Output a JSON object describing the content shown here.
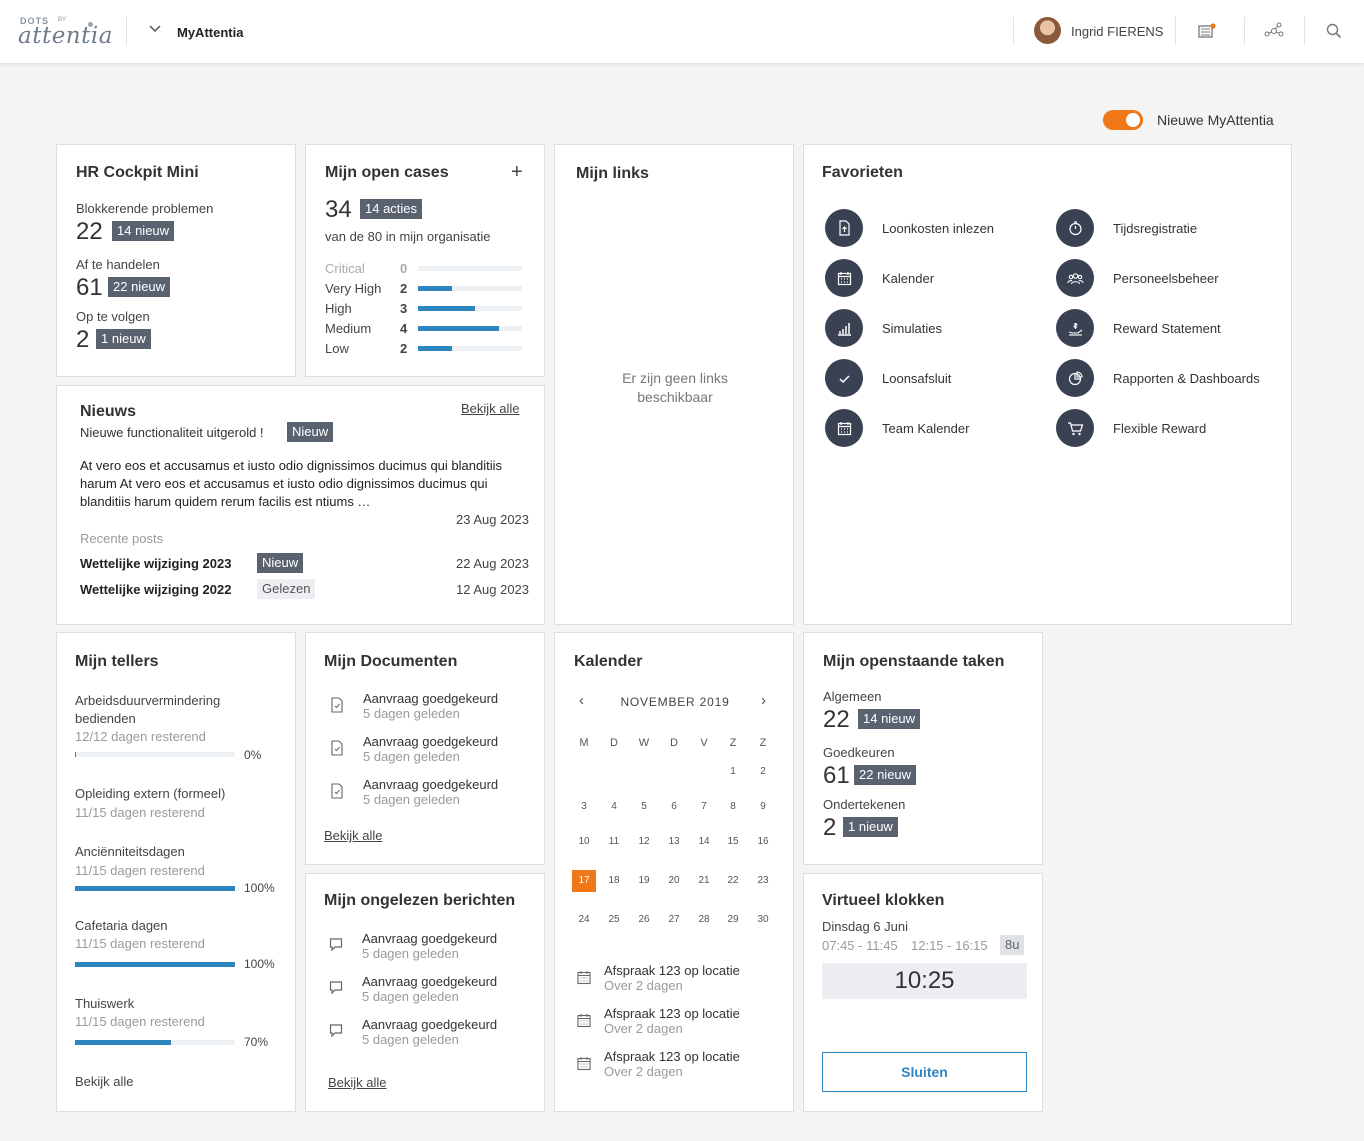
{
  "app": {
    "logo_dots": "DOTS",
    "logo_by": "BY",
    "logo_word": "attentia",
    "name": "MyAttentia",
    "user": "Ingrid FIERENS"
  },
  "toggle": {
    "label": "Nieuwe MyAttentia",
    "on": true
  },
  "colors": {
    "accent": "#f07818",
    "bar": "#2d86c0",
    "dark": "#3a4152",
    "badge": "#5a6270"
  },
  "hr": {
    "title": "HR Cockpit Mini",
    "items": [
      {
        "label": "Blokkerende problemen",
        "value": "22",
        "badge": "14 nieuw"
      },
      {
        "label": "Af te handelen",
        "value": "61",
        "badge": "22 nieuw"
      },
      {
        "label": "Op te volgen",
        "value": "2",
        "badge": "1 nieuw"
      }
    ]
  },
  "cases": {
    "title": "Mijn open cases",
    "plus": "+",
    "count": "34",
    "badge": "14 acties",
    "sub": "van de 80 in mijn organisatie",
    "rows": [
      {
        "label": "Critical",
        "value": "0",
        "level": 0
      },
      {
        "label": "Very High",
        "value": "2",
        "level": 0.33
      },
      {
        "label": "High",
        "value": "3",
        "level": 0.55
      },
      {
        "label": "Medium",
        "value": "4",
        "level": 0.78
      },
      {
        "label": "Low",
        "value": "2",
        "level": 0.33
      }
    ]
  },
  "links": {
    "title": "Mijn links",
    "empty": "Er zijn geen links beschikbaar"
  },
  "fav": {
    "title": "Favorieten",
    "items": [
      {
        "label": "Loonkosten inlezen",
        "icon": "file-upload-icon"
      },
      {
        "label": "Tijdsregistratie",
        "icon": "stopwatch-icon"
      },
      {
        "label": "Kalender",
        "icon": "calendar-icon"
      },
      {
        "label": "Personeelsbeheer",
        "icon": "people-icon"
      },
      {
        "label": "Simulaties",
        "icon": "bar-chart-icon"
      },
      {
        "label": "Reward Statement",
        "icon": "reward-hand-icon"
      },
      {
        "label": "Loonsafsluit",
        "icon": "check-icon"
      },
      {
        "label": "Rapporten & Dashboards",
        "icon": "pie-chart-icon"
      },
      {
        "label": "Team Kalender",
        "icon": "calendar-icon"
      },
      {
        "label": "Flexible Reward",
        "icon": "cart-icon"
      }
    ]
  },
  "news": {
    "title": "Nieuws",
    "view_all": "Bekijk alle",
    "headline": "Nieuwe functionaliteit uitgerold !",
    "badge": "Nieuw",
    "body": "At vero eos et accusamus et iusto odio dignissimos ducimus qui blanditiis harum At vero eos et accusamus et iusto odio dignissimos ducimus qui blanditiis harum quidem rerum facilis est ntiums  …",
    "date": "23 Aug 2023",
    "recent_label": "Recente posts",
    "posts": [
      {
        "title": "Wettelijke wijziging 2023",
        "badge": "Nieuw",
        "date": "22 Aug 2023"
      },
      {
        "title": "Wettelijke wijziging 2022",
        "badge": "Gelezen",
        "date": "12 Aug 2023"
      }
    ]
  },
  "counters": {
    "title": "Mijn tellers",
    "view_all": "Bekijk alle",
    "items": [
      {
        "label": "Arbeidsduurvermindering bedienden",
        "sub": "12/12 dagen resterend",
        "pct": "0%",
        "level": 0
      },
      {
        "label": "Opleiding extern (formeel)",
        "sub": "11/15 dagen resterend"
      },
      {
        "label": "Anciënniteitsdagen",
        "sub": "11/15 dagen resterend",
        "pct": "100%",
        "level": 1
      },
      {
        "label": "Cafetaria dagen",
        "sub": "11/15 dagen resterend",
        "pct": "100%",
        "level": 1
      },
      {
        "label": "Thuiswerk",
        "sub": "11/15 dagen resterend",
        "pct": "70%",
        "level": 0.6
      }
    ]
  },
  "docs": {
    "title": "Mijn Documenten",
    "view_all": "Bekijk alle",
    "items": [
      {
        "title": "Aanvraag goedgekeurd",
        "sub": "5 dagen geleden"
      },
      {
        "title": "Aanvraag goedgekeurd",
        "sub": "5 dagen geleden"
      },
      {
        "title": "Aanvraag goedgekeurd",
        "sub": "5 dagen geleden"
      }
    ]
  },
  "msgs": {
    "title": "Mijn ongelezen berichten",
    "view_all": "Bekijk alle",
    "items": [
      {
        "title": "Aanvraag goedgekeurd",
        "sub": "5 dagen geleden"
      },
      {
        "title": "Aanvraag goedgekeurd",
        "sub": "5 dagen geleden"
      },
      {
        "title": "Aanvraag goedgekeurd",
        "sub": "5 dagen geleden"
      }
    ]
  },
  "cal": {
    "title": "Kalender",
    "month": "NOVEMBER 2019",
    "prev": "‹",
    "next": "›",
    "weekdays": [
      "M",
      "D",
      "W",
      "D",
      "V",
      "Z",
      "Z"
    ],
    "weeks": [
      [
        "",
        "",
        "",
        "",
        "",
        "1",
        "2"
      ],
      [
        "3",
        "4",
        "5",
        "6",
        "7",
        "8",
        "9"
      ],
      [
        "10",
        "11",
        "12",
        "13",
        "14",
        "15",
        "16"
      ],
      [
        "17",
        "18",
        "19",
        "20",
        "21",
        "22",
        "23"
      ],
      [
        "24",
        "25",
        "26",
        "27",
        "28",
        "29",
        "30"
      ]
    ],
    "selected": "17",
    "events": [
      {
        "title": "Afspraak 123 op locatie",
        "sub": "Over 2 dagen"
      },
      {
        "title": "Afspraak 123 op locatie",
        "sub": "Over 2 dagen"
      },
      {
        "title": "Afspraak 123 op locatie",
        "sub": "Over 2 dagen"
      }
    ]
  },
  "tasks": {
    "title": "Mijn openstaande taken",
    "items": [
      {
        "label": "Algemeen",
        "value": "22",
        "badge": "14 nieuw"
      },
      {
        "label": "Goedkeuren",
        "value": "61",
        "badge": "22 nieuw"
      },
      {
        "label": "Ondertekenen",
        "value": "2",
        "badge": "1 nieuw"
      }
    ]
  },
  "clock": {
    "title": "Virtueel klokken",
    "day": "Dinsdag 6 Juni",
    "slot1": "07:45 - 11:45",
    "slot2": "12:15 - 16:15",
    "hours": "8u",
    "time": "10:25",
    "button": "Sluiten"
  }
}
